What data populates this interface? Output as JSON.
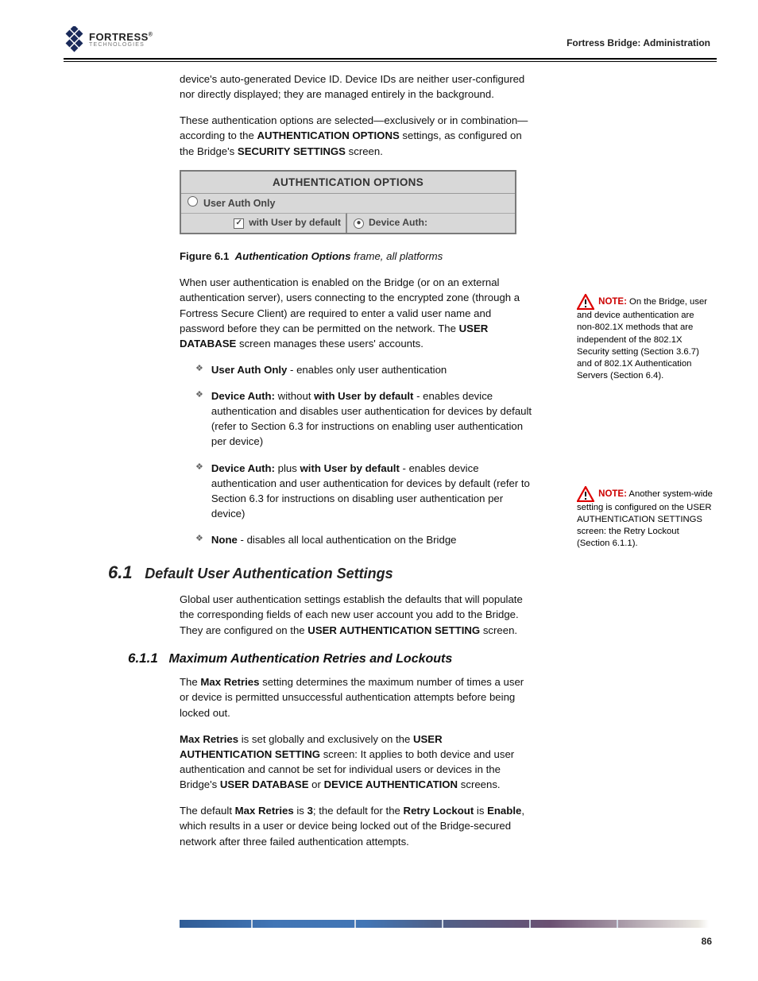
{
  "header": {
    "brand_main": "FORTRESS",
    "brand_sub": "TECHNOLOGIES",
    "reg": "®",
    "running_title": "Fortress Bridge: Administration"
  },
  "intro": {
    "p1": "device's auto-generated Device ID. Device IDs are neither user-configured nor directly displayed; they are managed entirely in the background.",
    "p2_a": "These authentication options are selected—exclusively or in combination—according to the ",
    "p2_b": "AUTHENTICATION OPTIONS",
    "p2_c": " settings, as configured on the Bridge's ",
    "p2_d": "SECURITY SETTINGS",
    "p2_e": " screen.",
    "p3_a": "Figure 6.1",
    "p3_b": "Authentication Options",
    "p3_c": " frame, all platforms"
  },
  "auth_box": {
    "title": "AUTHENTICATION OPTIONS",
    "row1": "User Auth Only",
    "left_cell": "with User by default",
    "right_cell": "Device Auth:"
  },
  "body": {
    "p4_a": "When user authentication is enabled on the Bridge (or on an external authentication server), users connecting to the encrypted zone (through a Fortress Secure Client) are required to enter a valid user name and password before they can be permitted on the network. The ",
    "p4_b": "USER DATABASE",
    "p4_c": " screen manages these users' accounts.",
    "bullet1_a": "User Auth Only",
    "bullet1_b": " - enables only user authentication",
    "bullet2_a": "Device Auth:",
    "bullet2_b": " without ",
    "bullet2_c": "with User by default",
    "bullet2_d": " - enables device authentication and disables user authentication for devices by default (refer to Section 6.3 for instructions on enabling user authentication per device)",
    "bullet3_a": "Device Auth:",
    "bullet3_b": " plus ",
    "bullet3_c": "with User by default",
    "bullet3_d": " - enables device authentication and user authentication for devices by default (refer to Section 6.3 for instructions on disabling user authentication per device)",
    "bullet4_a": "None",
    "bullet4_b": " - disables all local authentication on the Bridge"
  },
  "sections": {
    "s61_num": "6.1",
    "s61_title": "Default User Authentication Settings",
    "s61_p_a": "Global user authentication settings establish the defaults that will populate the corresponding fields of each new user account you add to the Bridge. They are configured on the ",
    "s61_p_b": "USER AUTHENTICATION SETTING",
    "s61_p_c": " screen.",
    "s611_num": "6.1.1",
    "s611_title": "Maximum Authentication Retries and Lockouts",
    "s611_p_a": "The ",
    "s611_p_b": "Max Retries",
    "s611_p_c": " setting determines the maximum number of times a user or device is permitted unsuccessful authentication attempts before being locked out.",
    "s611_p2_a": "Max Retries",
    "s611_p2_b": " is set globally and exclusively on the ",
    "s611_p2_c": "USER AUTHENTICATION SETTING",
    "s611_p2_d": " screen: ",
    "s611_p2_e": "It applies to both device and user authentication and cannot be set for individual users or devices in the Bridge's ",
    "s611_p2_f": "USER DATABASE",
    "s611_p2_g": " or ",
    "s611_p2_h": "DEVICE AUTHENTICATION",
    "s611_p2_i": " screens.",
    "s611_p3_a": "The default ",
    "s611_p3_b": "Max Retries",
    "s611_p3_c": " is ",
    "s611_p3_d": "3",
    "s611_p3_e": "; the default for the ",
    "s611_p3_f": "Retry Lockout",
    "s611_p3_g": " is ",
    "s611_p3_h": "Enable",
    "s611_p3_i": ", which results in a user or device being locked out of the Bridge-secured network after three failed authentication attempts."
  },
  "notes": {
    "n1_title": "NOTE:",
    "n1_body": " On the Bridge, user and device authentication are non-802.1X methods that are independent of the 802.1X Security setting (Section 3.6.7) and of 802.1X Authentication Servers (Section 6.4).",
    "n2_title": "NOTE:",
    "n2_body": " Another system-wide setting is configured on the USER AUTHENTICATION SETTINGS screen: the Retry Lockout (Section 6.1.1)."
  },
  "footer": {
    "page": "86"
  }
}
